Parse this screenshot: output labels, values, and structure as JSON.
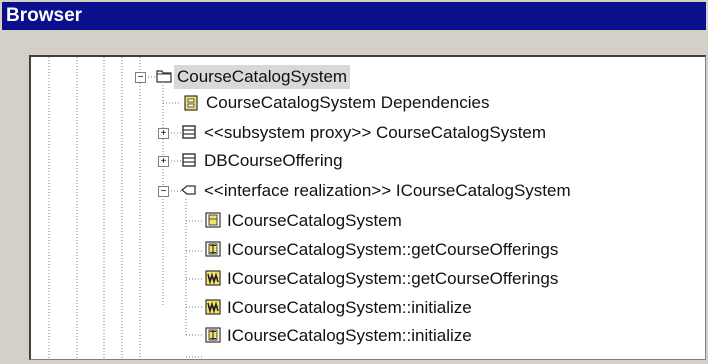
{
  "window": {
    "title": "Browser"
  },
  "tree": {
    "nodes": [
      {
        "label": "CourseCatalogSystem",
        "icon": "package-folder-icon",
        "expander": "−",
        "selected": true
      },
      {
        "label": "CourseCatalogSystem Dependencies",
        "icon": "class-diagram-icon"
      },
      {
        "label": "<<subsystem proxy>> CourseCatalogSystem",
        "icon": "class-icon",
        "expander": "+"
      },
      {
        "label": "DBCourseOffering",
        "icon": "class-icon",
        "expander": "+"
      },
      {
        "label": "<<interface realization>> ICourseCatalogSystem",
        "icon": "realization-icon",
        "expander": "−"
      },
      {
        "label": "ICourseCatalogSystem",
        "icon": "class-diagram-icon"
      },
      {
        "label": "ICourseCatalogSystem::getCourseOfferings",
        "icon": "interaction-diagram-icon"
      },
      {
        "label": "ICourseCatalogSystem::getCourseOfferings",
        "icon": "collaboration-diagram-icon"
      },
      {
        "label": "ICourseCatalogSystem::initialize",
        "icon": "collaboration-diagram-icon"
      },
      {
        "label": "ICourseCatalogSystem::initialize",
        "icon": "interaction-diagram-icon"
      }
    ]
  }
}
